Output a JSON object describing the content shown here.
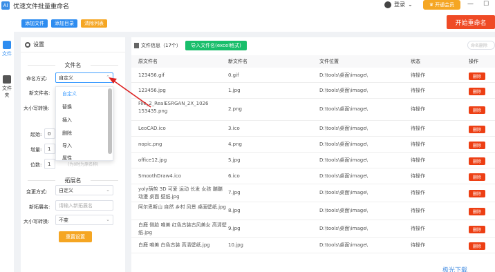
{
  "app": {
    "title": "优速文件批量重命名",
    "icon_text": "AI"
  },
  "topbar": {
    "login_label": "登录",
    "vip_label": "开通会员"
  },
  "sidebar": {
    "items": [
      {
        "label": "文件"
      },
      {
        "label": "文件夹"
      }
    ]
  },
  "toolbar": {
    "add_file": "添加文件",
    "add_dir": "添加目录",
    "clear": "清除列表",
    "start": "开始重命名"
  },
  "settings": {
    "title": "设置",
    "filename_section": "文件名",
    "method_label": "命名方式:",
    "method_value": "自定义",
    "new_name_label": "新文件名:",
    "case_label": "大小写转换:",
    "start_label": "起始:",
    "start_value": "0",
    "step_label": "增量:",
    "step_value": "1",
    "digits_label": "位数:",
    "digits_value": "1",
    "hint": "(为0时为原名称)",
    "ext_section": "拓展名",
    "ext_method_label": "变更方式:",
    "ext_method_value": "自定义",
    "new_ext_label": "新拓展名:",
    "new_ext_placeholder": "请输入新拓展名",
    "ext_case_label": "大小写转换:",
    "ext_case_value": "不变",
    "reset": "重置设置"
  },
  "dropdown": {
    "options": [
      "自定义",
      "替换",
      "插入",
      "删除",
      "导入",
      "属性"
    ],
    "selected": "自定义"
  },
  "main": {
    "info_label": "文件信息",
    "count": "（17个）",
    "import_btn": "导入文件名(excel格式)",
    "search_placeholder": "命名删除",
    "columns": [
      "原文件名",
      "新文件名",
      "文件位置",
      "状态",
      "操作"
    ],
    "rows": [
      {
        "orig": "123456.gif",
        "new": "0.gif",
        "loc": "D:\\tools\\桌面\\image\\",
        "status": "待操作",
        "op": "删除"
      },
      {
        "orig": "123456.jpg",
        "new": "1.jpg",
        "loc": "D:\\tools\\桌面\\image\\",
        "status": "待操作",
        "op": "删除"
      },
      {
        "orig": "File_2_RealESRGAN_2X_1026 153435.png",
        "new": "2.png",
        "loc": "D:\\tools\\桌面\\image\\",
        "status": "待操作",
        "op": "删除"
      },
      {
        "orig": "LeoCAD.ico",
        "new": "3.ico",
        "loc": "D:\\tools\\桌面\\image\\",
        "status": "待操作",
        "op": "删除"
      },
      {
        "orig": "nopic.png",
        "new": "4.png",
        "loc": "D:\\tools\\桌面\\image\\",
        "status": "待操作",
        "op": "删除"
      },
      {
        "orig": "office12.jpg",
        "new": "5.jpg",
        "loc": "D:\\tools\\桌面\\image\\",
        "status": "待操作",
        "op": "删除"
      },
      {
        "orig": "SmoothDraw4.ico",
        "new": "6.ico",
        "loc": "D:\\tools\\桌面\\image\\",
        "status": "待操作",
        "op": "删除"
      },
      {
        "orig": "yoly萌剪 3D 可爱 运动 长发 女孩 蹦蹦 动漫 桌面 壁纸.jpg",
        "new": "7.jpg",
        "loc": "D:\\tools\\桌面\\image\\",
        "status": "待操作",
        "op": "删除"
      },
      {
        "orig": "阿尔卑斯山 自然 乡村 风景 桌面壁纸.jpg",
        "new": "8.jpg",
        "loc": "D:\\tools\\桌面\\image\\",
        "status": "待操作",
        "op": "删除"
      },
      {
        "orig": "白鹿 侧脸 唯美 红色古装古风美女 高清壁纸.jpg",
        "new": "9.jpg",
        "loc": "D:\\tools\\桌面\\image\\",
        "status": "待操作",
        "op": "删除"
      },
      {
        "orig": "白鹿 唯美 白色古装 高清壁纸.jpg",
        "new": "10.jpg",
        "loc": "D:\\tools\\桌面\\image\\",
        "status": "待操作",
        "op": "删除"
      }
    ]
  },
  "watermark": "极光下载",
  "colors": {
    "blue": "#2d8cf0",
    "orange": "#f5a623",
    "red": "#ed3f14",
    "green": "#19be6b"
  }
}
